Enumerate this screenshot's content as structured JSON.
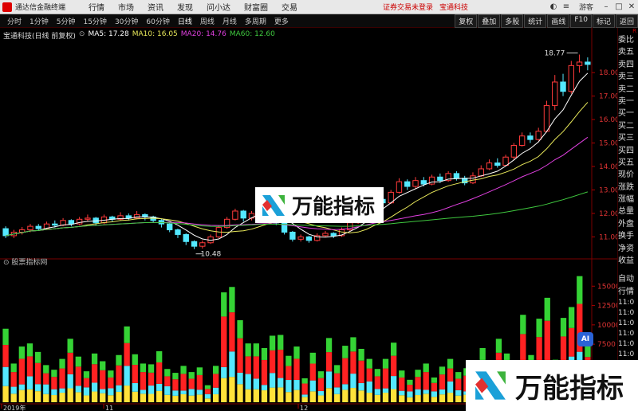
{
  "app": {
    "title": "通达信金融终端",
    "menu": [
      "行情",
      "市场",
      "资讯",
      "发现",
      "问小达",
      "财富圈",
      "交易"
    ],
    "notice": "证券交易未登录",
    "brand_link": "宝通科技",
    "right_tools": {
      "guest": "游客"
    }
  },
  "toolbar": {
    "periods": [
      "分时",
      "1分钟",
      "5分钟",
      "15分钟",
      "30分钟",
      "60分钟",
      "日线",
      "周线",
      "月线",
      "多周期",
      "更多"
    ],
    "active_period": "日线",
    "buttons": [
      "复权",
      "叠加",
      "多股",
      "统计",
      "画线",
      "F10",
      "标记",
      "返回"
    ]
  },
  "stock": {
    "name_label": "宝通科技(日线 前复权)",
    "ma": [
      {
        "label": "MA5: 17.28",
        "color": "#ffffff"
      },
      {
        "label": "MA10: 16.05",
        "color": "#e8e85a"
      },
      {
        "label": "MA20: 14.76",
        "color": "#e040e0"
      },
      {
        "label": "MA60: 12.60",
        "color": "#3fc83f"
      }
    ]
  },
  "volume_panel": {
    "label": "股票指标网"
  },
  "side_panel": {
    "corner": "R",
    "items": [
      "委比",
      "卖五",
      "卖四",
      "卖三",
      "卖二",
      "卖一",
      "买一",
      "买二",
      "买三",
      "买四",
      "买五",
      "现价",
      "涨跌",
      "涨幅",
      "总量",
      "外盘",
      "换手",
      "净资",
      "收益"
    ],
    "bottom_items": [
      "自动",
      "行情"
    ],
    "times": [
      "11:0",
      "11:0",
      "11:0",
      "11:0",
      "11:0",
      "11:0",
      "11:0"
    ]
  },
  "watermark": {
    "text": "万能指标"
  },
  "ai_badge": "AI",
  "chart_data": {
    "type": "candlestick",
    "price_axis": {
      "ylim": [
        10.3,
        19.5
      ],
      "ticks": [
        11.0,
        12.0,
        13.0,
        14.0,
        15.0,
        16.0,
        17.0,
        18.0
      ]
    },
    "annotations": {
      "high": "18.77",
      "low": "10.48"
    },
    "x_labels": [
      "2019年",
      "11",
      "12"
    ],
    "candles": [
      [
        11.35,
        11.05,
        11.45,
        10.95
      ],
      [
        11.05,
        11.2,
        11.3,
        10.95
      ],
      [
        11.2,
        11.3,
        11.42,
        11.1
      ],
      [
        11.3,
        11.45,
        11.55,
        11.2
      ],
      [
        11.45,
        11.35,
        11.55,
        11.25
      ],
      [
        11.35,
        11.55,
        11.65,
        11.3
      ],
      [
        11.55,
        11.5,
        11.7,
        11.4
      ],
      [
        11.5,
        11.7,
        11.8,
        11.45
      ],
      [
        11.7,
        11.55,
        11.75,
        11.45
      ],
      [
        11.55,
        11.75,
        11.85,
        11.5
      ],
      [
        11.75,
        11.8,
        11.95,
        11.65
      ],
      [
        11.8,
        11.6,
        11.85,
        11.5
      ],
      [
        11.6,
        11.85,
        11.95,
        11.55
      ],
      [
        11.85,
        11.75,
        11.9,
        11.65
      ],
      [
        11.75,
        11.9,
        12.05,
        11.7
      ],
      [
        11.9,
        11.8,
        12.0,
        11.7
      ],
      [
        11.8,
        11.95,
        12.1,
        11.75
      ],
      [
        11.95,
        11.85,
        12.0,
        11.7
      ],
      [
        11.85,
        11.7,
        11.9,
        11.6
      ],
      [
        11.7,
        11.55,
        11.75,
        11.4
      ],
      [
        11.55,
        11.3,
        11.6,
        11.2
      ],
      [
        11.3,
        11.1,
        11.35,
        10.95
      ],
      [
        11.1,
        10.8,
        11.15,
        10.65
      ],
      [
        10.8,
        10.6,
        10.85,
        10.48
      ],
      [
        10.6,
        10.75,
        10.85,
        10.5
      ],
      [
        10.75,
        11.0,
        11.1,
        10.7
      ],
      [
        11.0,
        11.4,
        11.5,
        10.95
      ],
      [
        11.4,
        11.75,
        11.85,
        11.35
      ],
      [
        11.75,
        12.1,
        12.2,
        11.7
      ],
      [
        12.1,
        11.8,
        12.15,
        11.65
      ],
      [
        11.8,
        12.0,
        12.1,
        11.7
      ],
      [
        12.0,
        12.2,
        12.3,
        11.9
      ],
      [
        12.2,
        11.95,
        12.25,
        11.85
      ],
      [
        11.95,
        11.6,
        12.0,
        11.5
      ],
      [
        11.6,
        11.2,
        11.65,
        11.1
      ],
      [
        11.2,
        10.9,
        11.25,
        10.8
      ],
      [
        10.9,
        11.0,
        11.1,
        10.8
      ],
      [
        11.0,
        10.85,
        11.05,
        10.75
      ],
      [
        10.85,
        11.05,
        11.15,
        10.8
      ],
      [
        11.05,
        11.15,
        11.25,
        11.0
      ],
      [
        11.15,
        11.05,
        11.2,
        10.95
      ],
      [
        11.05,
        11.3,
        11.4,
        11.0
      ],
      [
        11.3,
        11.6,
        11.7,
        11.25
      ],
      [
        11.6,
        11.95,
        12.05,
        11.55
      ],
      [
        11.95,
        12.35,
        12.5,
        11.9
      ],
      [
        12.35,
        12.6,
        12.75,
        12.2
      ],
      [
        12.6,
        12.45,
        12.7,
        12.3
      ],
      [
        12.45,
        12.9,
        13.0,
        12.4
      ],
      [
        12.9,
        13.35,
        13.5,
        12.85
      ],
      [
        13.35,
        13.15,
        13.45,
        13.0
      ],
      [
        13.15,
        13.4,
        13.55,
        13.05
      ],
      [
        13.4,
        13.25,
        13.55,
        13.15
      ],
      [
        13.25,
        13.55,
        13.65,
        13.2
      ],
      [
        13.55,
        13.4,
        13.7,
        13.3
      ],
      [
        13.4,
        13.7,
        13.8,
        13.35
      ],
      [
        13.7,
        13.5,
        13.8,
        13.4
      ],
      [
        13.5,
        13.3,
        13.6,
        13.2
      ],
      [
        13.3,
        13.6,
        13.75,
        13.25
      ],
      [
        13.6,
        13.9,
        14.05,
        13.55
      ],
      [
        13.9,
        14.15,
        14.3,
        13.85
      ],
      [
        14.15,
        14.05,
        14.35,
        13.95
      ],
      [
        14.05,
        14.4,
        14.5,
        14.0
      ],
      [
        14.4,
        14.9,
        15.0,
        14.3
      ],
      [
        14.9,
        15.3,
        15.45,
        14.85
      ],
      [
        15.3,
        15.15,
        15.45,
        15.0
      ],
      [
        15.15,
        15.5,
        15.65,
        15.1
      ],
      [
        15.5,
        16.6,
        16.8,
        15.45
      ],
      [
        16.6,
        17.6,
        17.9,
        16.4
      ],
      [
        17.6,
        17.2,
        17.95,
        17.0
      ],
      [
        17.2,
        18.3,
        18.5,
        17.1
      ],
      [
        18.3,
        18.45,
        18.77,
        18.0
      ],
      [
        18.45,
        18.35,
        18.65,
        18.1
      ]
    ],
    "volume_axis": {
      "ylim": [
        0,
        17500
      ],
      "ticks": [
        5000,
        7500,
        10000,
        12500,
        15000
      ]
    },
    "volume": [
      9500,
      5000,
      7200,
      7600,
      6500,
      4800,
      4200,
      5600,
      8200,
      5900,
      4000,
      6300,
      5300,
      4100,
      6100,
      9800,
      6200,
      5000,
      4900,
      6600,
      4300,
      3800,
      4700,
      3900,
      4500,
      2200,
      4700,
      14200,
      14900,
      10600,
      7600,
      7600,
      7000,
      8600,
      8700,
      6000,
      7200,
      3100,
      6400,
      4000,
      8300,
      4800,
      7300,
      8400,
      6900,
      5600,
      4300,
      5600,
      7700,
      4100,
      2900,
      4200,
      5000,
      3200,
      4600,
      5600,
      3900,
      4400,
      3800,
      7000,
      4300,
      8200,
      6300,
      2700,
      11300,
      6100,
      10800,
      13500,
      5500,
      10900,
      12300,
      16300,
      7500
    ]
  }
}
